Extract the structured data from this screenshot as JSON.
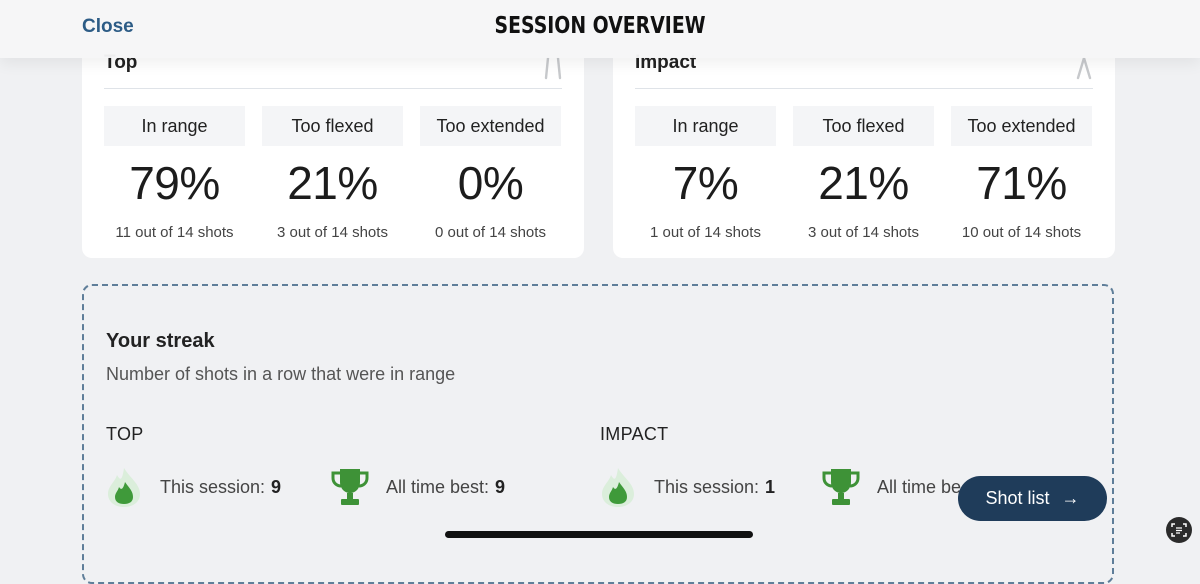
{
  "header": {
    "close_label": "Close",
    "title": "SESSION OVERVIEW"
  },
  "cards": {
    "left": {
      "title": "Top",
      "stats": [
        {
          "label": "In range",
          "pct": "79%",
          "count": "11 out of 14 shots"
        },
        {
          "label": "Too flexed",
          "pct": "21%",
          "count": "3 out of 14 shots"
        },
        {
          "label": "Too extended",
          "pct": "0%",
          "count": "0 out of 14 shots"
        }
      ]
    },
    "right": {
      "title": "Impact",
      "stats": [
        {
          "label": "In range",
          "pct": "7%",
          "count": "1 out of 14 shots"
        },
        {
          "label": "Too flexed",
          "pct": "21%",
          "count": "3 out of 14 shots"
        },
        {
          "label": "Too extended",
          "pct": "71%",
          "count": "10 out of 14 shots"
        }
      ]
    }
  },
  "streak": {
    "title": "Your streak",
    "subtitle": "Number of shots in a row that were in range",
    "top": {
      "label": "TOP",
      "session_label": "This session:",
      "session_value": "9",
      "best_label": "All time best:",
      "best_value": "9"
    },
    "impact": {
      "label": "IMPACT",
      "session_label": "This session:",
      "session_value": "1",
      "best_label": "All time be",
      "best_value": ""
    }
  },
  "shot_list": {
    "label": "Shot list",
    "arrow": "→"
  },
  "colors": {
    "accent": "#2d5c86",
    "button_bg": "#1f3c5a",
    "flame_green": "#3f9a3a",
    "trophy_green": "#3e9237",
    "dashed_border": "#5f7e99"
  }
}
